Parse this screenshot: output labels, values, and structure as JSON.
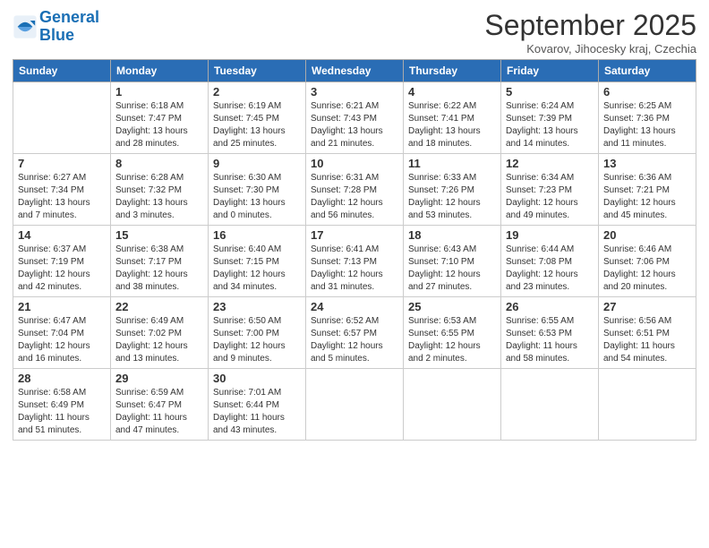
{
  "header": {
    "logo_general": "General",
    "logo_blue": "Blue",
    "month": "September 2025",
    "location": "Kovarov, Jihocesky kraj, Czechia"
  },
  "weekdays": [
    "Sunday",
    "Monday",
    "Tuesday",
    "Wednesday",
    "Thursday",
    "Friday",
    "Saturday"
  ],
  "weeks": [
    [
      {
        "day": "",
        "info": ""
      },
      {
        "day": "1",
        "info": "Sunrise: 6:18 AM\nSunset: 7:47 PM\nDaylight: 13 hours\nand 28 minutes."
      },
      {
        "day": "2",
        "info": "Sunrise: 6:19 AM\nSunset: 7:45 PM\nDaylight: 13 hours\nand 25 minutes."
      },
      {
        "day": "3",
        "info": "Sunrise: 6:21 AM\nSunset: 7:43 PM\nDaylight: 13 hours\nand 21 minutes."
      },
      {
        "day": "4",
        "info": "Sunrise: 6:22 AM\nSunset: 7:41 PM\nDaylight: 13 hours\nand 18 minutes."
      },
      {
        "day": "5",
        "info": "Sunrise: 6:24 AM\nSunset: 7:39 PM\nDaylight: 13 hours\nand 14 minutes."
      },
      {
        "day": "6",
        "info": "Sunrise: 6:25 AM\nSunset: 7:36 PM\nDaylight: 13 hours\nand 11 minutes."
      }
    ],
    [
      {
        "day": "7",
        "info": "Sunrise: 6:27 AM\nSunset: 7:34 PM\nDaylight: 13 hours\nand 7 minutes."
      },
      {
        "day": "8",
        "info": "Sunrise: 6:28 AM\nSunset: 7:32 PM\nDaylight: 13 hours\nand 3 minutes."
      },
      {
        "day": "9",
        "info": "Sunrise: 6:30 AM\nSunset: 7:30 PM\nDaylight: 13 hours\nand 0 minutes."
      },
      {
        "day": "10",
        "info": "Sunrise: 6:31 AM\nSunset: 7:28 PM\nDaylight: 12 hours\nand 56 minutes."
      },
      {
        "day": "11",
        "info": "Sunrise: 6:33 AM\nSunset: 7:26 PM\nDaylight: 12 hours\nand 53 minutes."
      },
      {
        "day": "12",
        "info": "Sunrise: 6:34 AM\nSunset: 7:23 PM\nDaylight: 12 hours\nand 49 minutes."
      },
      {
        "day": "13",
        "info": "Sunrise: 6:36 AM\nSunset: 7:21 PM\nDaylight: 12 hours\nand 45 minutes."
      }
    ],
    [
      {
        "day": "14",
        "info": "Sunrise: 6:37 AM\nSunset: 7:19 PM\nDaylight: 12 hours\nand 42 minutes."
      },
      {
        "day": "15",
        "info": "Sunrise: 6:38 AM\nSunset: 7:17 PM\nDaylight: 12 hours\nand 38 minutes."
      },
      {
        "day": "16",
        "info": "Sunrise: 6:40 AM\nSunset: 7:15 PM\nDaylight: 12 hours\nand 34 minutes."
      },
      {
        "day": "17",
        "info": "Sunrise: 6:41 AM\nSunset: 7:13 PM\nDaylight: 12 hours\nand 31 minutes."
      },
      {
        "day": "18",
        "info": "Sunrise: 6:43 AM\nSunset: 7:10 PM\nDaylight: 12 hours\nand 27 minutes."
      },
      {
        "day": "19",
        "info": "Sunrise: 6:44 AM\nSunset: 7:08 PM\nDaylight: 12 hours\nand 23 minutes."
      },
      {
        "day": "20",
        "info": "Sunrise: 6:46 AM\nSunset: 7:06 PM\nDaylight: 12 hours\nand 20 minutes."
      }
    ],
    [
      {
        "day": "21",
        "info": "Sunrise: 6:47 AM\nSunset: 7:04 PM\nDaylight: 12 hours\nand 16 minutes."
      },
      {
        "day": "22",
        "info": "Sunrise: 6:49 AM\nSunset: 7:02 PM\nDaylight: 12 hours\nand 13 minutes."
      },
      {
        "day": "23",
        "info": "Sunrise: 6:50 AM\nSunset: 7:00 PM\nDaylight: 12 hours\nand 9 minutes."
      },
      {
        "day": "24",
        "info": "Sunrise: 6:52 AM\nSunset: 6:57 PM\nDaylight: 12 hours\nand 5 minutes."
      },
      {
        "day": "25",
        "info": "Sunrise: 6:53 AM\nSunset: 6:55 PM\nDaylight: 12 hours\nand 2 minutes."
      },
      {
        "day": "26",
        "info": "Sunrise: 6:55 AM\nSunset: 6:53 PM\nDaylight: 11 hours\nand 58 minutes."
      },
      {
        "day": "27",
        "info": "Sunrise: 6:56 AM\nSunset: 6:51 PM\nDaylight: 11 hours\nand 54 minutes."
      }
    ],
    [
      {
        "day": "28",
        "info": "Sunrise: 6:58 AM\nSunset: 6:49 PM\nDaylight: 11 hours\nand 51 minutes."
      },
      {
        "day": "29",
        "info": "Sunrise: 6:59 AM\nSunset: 6:47 PM\nDaylight: 11 hours\nand 47 minutes."
      },
      {
        "day": "30",
        "info": "Sunrise: 7:01 AM\nSunset: 6:44 PM\nDaylight: 11 hours\nand 43 minutes."
      },
      {
        "day": "",
        "info": ""
      },
      {
        "day": "",
        "info": ""
      },
      {
        "day": "",
        "info": ""
      },
      {
        "day": "",
        "info": ""
      }
    ]
  ]
}
